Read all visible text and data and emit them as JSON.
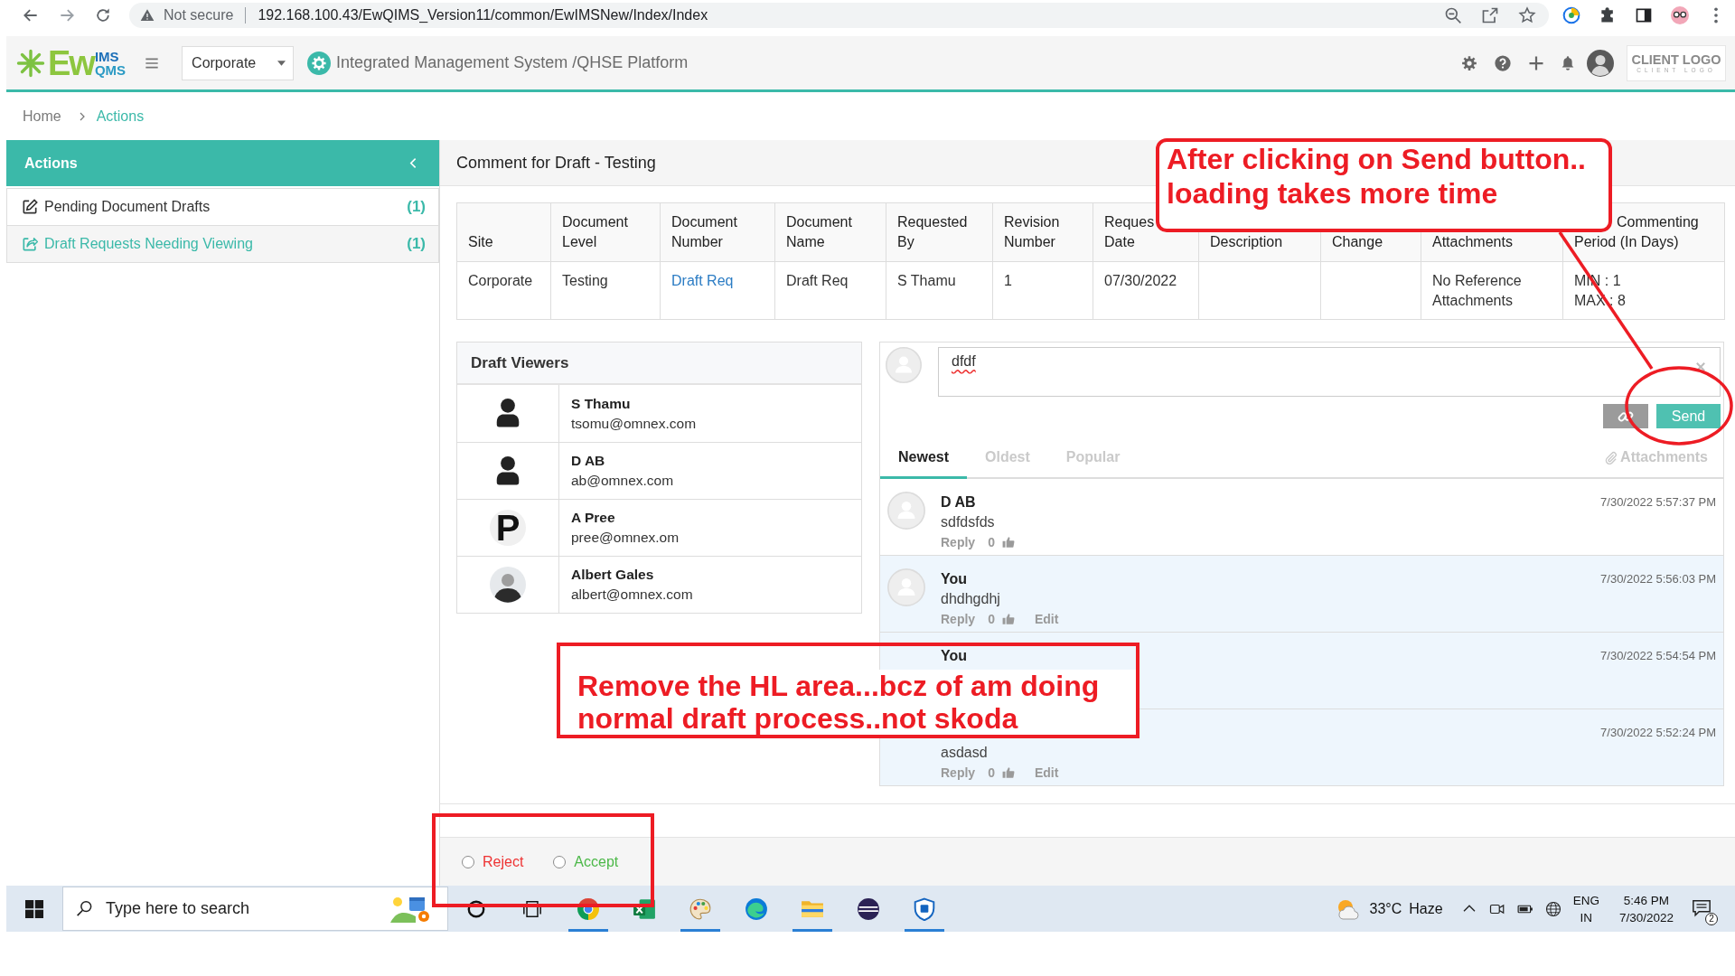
{
  "browser": {
    "security_label": "Not secure",
    "url": "192.168.100.43/EwQIMS_Version11/common/EwIMSNew/Index/Index"
  },
  "header": {
    "logo": {
      "main": "Ew",
      "top": "IMS",
      "bottom": "QMS"
    },
    "site_select": {
      "value": "Corporate"
    },
    "title": "Integrated Management System /QHSE Platform",
    "client_logo": {
      "title": "CLIENT LOGO",
      "subtitle": "CLIENT LOGO"
    }
  },
  "breadcrumb": {
    "items": [
      "Home",
      "Actions"
    ]
  },
  "sidebar": {
    "title": "Actions",
    "items": [
      {
        "kind": "edit",
        "label": "Pending Document Drafts",
        "count": "(1)",
        "selected": false
      },
      {
        "kind": "share",
        "label": "Draft Requests Needing Viewing",
        "count": "(1)",
        "selected": true
      }
    ]
  },
  "panel": {
    "title": "Comment for Draft - Testing",
    "table": {
      "columns": [
        {
          "lines": [
            "Site"
          ]
        },
        {
          "lines": [
            "Document",
            "Level"
          ]
        },
        {
          "lines": [
            "Document",
            "Number"
          ]
        },
        {
          "lines": [
            "Document",
            "Name"
          ]
        },
        {
          "lines": [
            "Requested",
            "By"
          ]
        },
        {
          "lines": [
            "Revision",
            "Number"
          ]
        },
        {
          "lines": [
            "Reques",
            "Date"
          ]
        },
        {
          "lines": [
            "Description"
          ]
        },
        {
          "lines": [
            "Change"
          ]
        },
        {
          "lines": [
            "Attachments"
          ]
        },
        {
          "lines": [
            "Commenting",
            "Period (In Days)"
          ]
        }
      ],
      "rows": [
        [
          {
            "kind": "text",
            "lines": [
              "Corporate"
            ]
          },
          {
            "kind": "text",
            "lines": [
              "Testing"
            ]
          },
          {
            "kind": "link",
            "lines": [
              "Draft Req"
            ]
          },
          {
            "kind": "text",
            "lines": [
              "Draft Req"
            ]
          },
          {
            "kind": "text",
            "lines": [
              "S Thamu"
            ]
          },
          {
            "kind": "text",
            "lines": [
              "1"
            ]
          },
          {
            "kind": "text",
            "lines": [
              "07/30/2022"
            ]
          },
          {
            "kind": "empty"
          },
          {
            "kind": "empty"
          },
          {
            "kind": "text",
            "lines": [
              "No Reference Attachments"
            ]
          },
          {
            "kind": "text",
            "lines": [
              "MIN : 1",
              "MAX : 8"
            ]
          }
        ]
      ]
    },
    "viewers": {
      "title": "Draft Viewers",
      "items": [
        {
          "kind": "silhouette",
          "name": "S Thamu",
          "email": "tsomu@omnex.com"
        },
        {
          "kind": "silhouette",
          "name": "D AB",
          "email": "ab@omnex.com"
        },
        {
          "kind": "initial",
          "initial": "P",
          "name": "A Pree",
          "email": "pree@omnex.om"
        },
        {
          "kind": "photo",
          "name": "Albert Gales",
          "email": "albert@omnex.com"
        }
      ]
    },
    "comments": {
      "composer": {
        "value": "dfdf"
      },
      "send_label": "Send",
      "tabs": [
        {
          "label": "Newest",
          "selected": true
        },
        {
          "label": "Oldest",
          "selected": false
        },
        {
          "label": "Popular",
          "selected": false
        }
      ],
      "attachments_label": "Attachments",
      "items": [
        {
          "avatar": true,
          "author": "D AB",
          "text": "sdfdsfds",
          "reply_label": "Reply",
          "likes": "0",
          "time": "7/30/2022 5:57:37 PM",
          "highlighted": false
        },
        {
          "avatar": true,
          "author": "You",
          "text": "dhdhgdhj",
          "reply_label": "Reply",
          "likes": "0",
          "edit_label": "Edit",
          "time": "7/30/2022 5:56:03 PM",
          "highlighted": true
        },
        {
          "avatar": false,
          "author": "You",
          "time": "7/30/2022 5:54:54 PM",
          "highlighted": true
        },
        {
          "avatar": false,
          "text": "asdasd",
          "reply_label": "Reply",
          "likes": "0",
          "edit_label": "Edit",
          "time": "7/30/2022 5:52:24 PM",
          "highlighted": true
        }
      ]
    }
  },
  "decision": {
    "options": [
      {
        "label": "Reject",
        "checked": false,
        "color": "#ee3333"
      },
      {
        "label": "Accept",
        "checked": false,
        "color": "#4cb848"
      }
    ]
  },
  "taskbar": {
    "search_placeholder": "Type here to search",
    "apps": [
      {
        "kind": "browser",
        "running": true
      },
      {
        "kind": "spreadsheet",
        "running": false
      },
      {
        "kind": "palette",
        "running": true
      },
      {
        "kind": "swirl",
        "running": false
      },
      {
        "kind": "folder",
        "running": true
      },
      {
        "kind": "stripes",
        "running": false
      },
      {
        "kind": "shield",
        "running": true
      }
    ],
    "weather": {
      "temperature": "33°C",
      "condition": "Haze"
    },
    "language": {
      "code": "ENG",
      "region": "IN"
    },
    "clock": {
      "time": "5:46 PM",
      "date": "7/30/2022"
    },
    "notifications": "2"
  },
  "annotations": [
    {
      "kind": "callout",
      "text": "After clicking on Send button.. loading takes more time"
    },
    {
      "kind": "note",
      "text": "Remove the HL area...bcz of am doing normal draft process..not skoda"
    }
  ]
}
